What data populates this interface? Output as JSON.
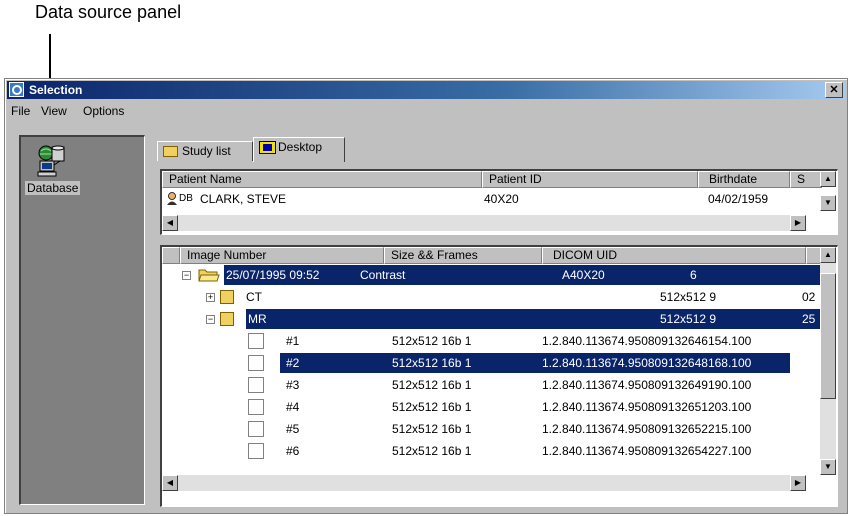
{
  "annotation": {
    "label": "Data source panel"
  },
  "window": {
    "title": "Selection",
    "close": "✕"
  },
  "menu": {
    "file": "File",
    "view": "View",
    "options": "Options"
  },
  "datasource": {
    "label": "Database"
  },
  "tabs": [
    {
      "label": "Study list"
    },
    {
      "label": "Desktop"
    }
  ],
  "patients": {
    "columns": [
      "Patient Name",
      "Patient ID",
      "Birthdate",
      "S"
    ],
    "rows": [
      {
        "prefix": "DB",
        "name": "CLARK, STEVE",
        "id": "40X20",
        "birthdate": "04/02/1959"
      }
    ]
  },
  "series": {
    "columns": [
      "Image Number",
      "Size && Frames",
      "DICOM UID"
    ],
    "study": {
      "datetime": "25/07/1995  09:52",
      "description": "Contrast",
      "id": "A40X20",
      "count": "6"
    },
    "groups": [
      {
        "name": "CT",
        "size": "512x512  9",
        "extra": "02"
      },
      {
        "name": "MR",
        "size": "512x512  9",
        "extra": "25"
      }
    ],
    "images": [
      {
        "number": "#1",
        "size": "512x512 16b 1",
        "uid": "1.2.840.113674.950809132646154.100"
      },
      {
        "number": "#2",
        "size": "512x512 16b 1",
        "uid": "1.2.840.113674.950809132648168.100"
      },
      {
        "number": "#3",
        "size": "512x512 16b 1",
        "uid": "1.2.840.113674.950809132649190.100"
      },
      {
        "number": "#4",
        "size": "512x512 16b 1",
        "uid": "1.2.840.113674.950809132651203.100"
      },
      {
        "number": "#5",
        "size": "512x512 16b 1",
        "uid": "1.2.840.113674.950809132652215.100"
      },
      {
        "number": "#6",
        "size": "512x512 16b 1",
        "uid": "1.2.840.113674.950809132654227.100"
      }
    ]
  },
  "colors": {
    "highlight": "#0a246a",
    "panel": "#808080",
    "face": "#c0c0c0"
  },
  "icons": {
    "expand": "+",
    "collapse": "−",
    "up": "▲",
    "down": "▼",
    "left": "◀",
    "right": "▶"
  }
}
